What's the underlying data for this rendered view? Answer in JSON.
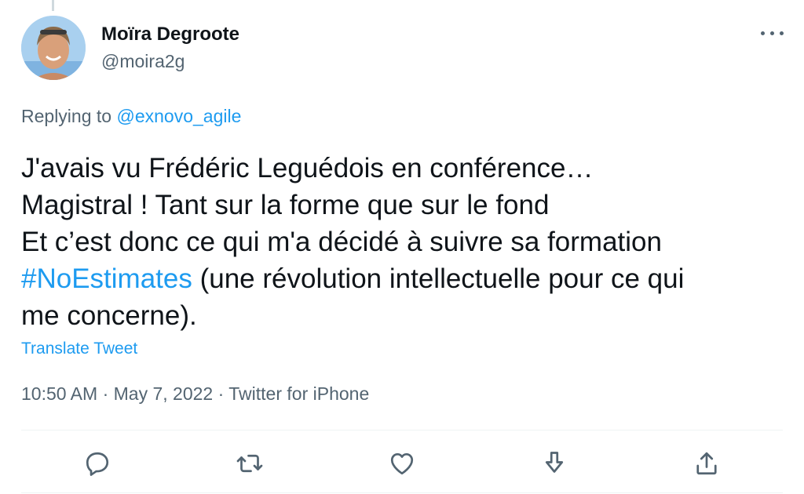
{
  "author": {
    "name": "Moïra Degroote",
    "handle": "@moira2g"
  },
  "reply": {
    "prefix": "Replying to",
    "mention": "@exnovo_agile"
  },
  "tweet": {
    "line1": "J'avais vu Frédéric Leguédois en conférence…",
    "line2": "Magistral ! Tant sur la forme que sur le fond",
    "line3": "Et c’est donc ce qui m'a décidé à suivre sa formation",
    "hashtag": "#NoEstimates",
    "line4_rest": " (une révolution intellectuelle pour ce qui",
    "line5": "me concerne)."
  },
  "translate_label": "Translate Tweet",
  "meta": {
    "time": "10:50 AM",
    "separator": " · ",
    "date": "May 7, 2022",
    "source": "Twitter for iPhone"
  },
  "actions": {
    "reply": "reply-icon",
    "retweet": "retweet-icon",
    "like": "heart-icon",
    "download": "download-icon",
    "share": "share-icon"
  },
  "colors": {
    "accent": "#1d9bf0",
    "text": "#0f1419",
    "secondary": "#536471",
    "divider": "#eff3f4"
  }
}
